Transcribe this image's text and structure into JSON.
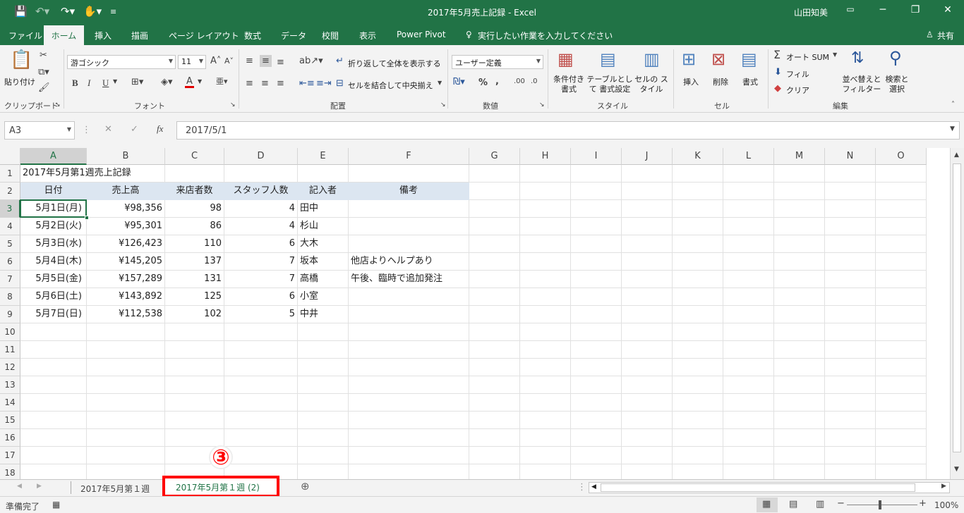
{
  "window": {
    "title": "2017年5月売上記録 - Excel",
    "user": "山田知美"
  },
  "tabs": [
    "ファイル",
    "ホーム",
    "挿入",
    "描画",
    "ページ レイアウト",
    "数式",
    "データ",
    "校閲",
    "表示",
    "Power Pivot"
  ],
  "tell_me": "実行したい作業を入力してください",
  "share": "共有",
  "ribbon": {
    "clipboard": {
      "paste": "貼り付け",
      "label": "クリップボード"
    },
    "font": {
      "name": "游ゴシック",
      "size": "11",
      "label": "フォント",
      "bold": "B",
      "italic": "I",
      "underline": "U"
    },
    "alignment": {
      "wrap": "折り返して全体を表示する",
      "merge": "セルを結合して中央揃え",
      "label": "配置"
    },
    "number": {
      "format": "ユーザー定義",
      "label": "数値",
      "percent": "%",
      "comma": ","
    },
    "styles": {
      "conditional": "条件付き 書式",
      "table": "テーブルとして 書式設定",
      "cell": "セルの スタイル",
      "label": "スタイル"
    },
    "cells": {
      "insert": "挿入",
      "delete": "削除",
      "format": "書式",
      "label": "セル"
    },
    "editing": {
      "autosum": "オート SUM",
      "fill": "フィル",
      "clear": "クリア",
      "sort": "並べ替えと フィルター",
      "find": "検索と 選択",
      "label": "編集"
    }
  },
  "formula_bar": {
    "name_box": "A3",
    "fx": "fx",
    "value": "2017/5/1"
  },
  "columns": [
    "A",
    "B",
    "C",
    "D",
    "E",
    "F",
    "G",
    "H",
    "I",
    "J",
    "K",
    "L",
    "M",
    "N",
    "O"
  ],
  "rows": [
    "1",
    "2",
    "3",
    "4",
    "5",
    "6",
    "7",
    "8",
    "9",
    "10",
    "11",
    "12",
    "13",
    "14",
    "15",
    "16",
    "17",
    "18"
  ],
  "sheet": {
    "title": "2017年5月第1週売上記録",
    "headers": [
      "日付",
      "売上高",
      "来店者数",
      "スタッフ人数",
      "記入者",
      "備考"
    ],
    "data": [
      [
        "5月1日(月)",
        "¥98,356",
        "98",
        "4",
        "田中",
        ""
      ],
      [
        "5月2日(火)",
        "¥95,301",
        "86",
        "4",
        "杉山",
        ""
      ],
      [
        "5月3日(水)",
        "¥126,423",
        "110",
        "6",
        "大木",
        ""
      ],
      [
        "5月4日(木)",
        "¥145,205",
        "137",
        "7",
        "坂本",
        "他店よりヘルプあり"
      ],
      [
        "5月5日(金)",
        "¥157,289",
        "131",
        "7",
        "高橋",
        "午後、臨時で追加発注"
      ],
      [
        "5月6日(土)",
        "¥143,892",
        "125",
        "6",
        "小室",
        ""
      ],
      [
        "5月7日(日)",
        "¥112,538",
        "102",
        "5",
        "中井",
        ""
      ]
    ]
  },
  "sheet_tabs": [
    "2017年5月第１週",
    "2017年5月第１週 (2)"
  ],
  "annotation": "③",
  "status": {
    "ready": "準備完了",
    "zoom": "100%"
  },
  "colors": {
    "accent": "#217346",
    "header_fill": "#dce6f1",
    "highlight": "#ff0000"
  }
}
